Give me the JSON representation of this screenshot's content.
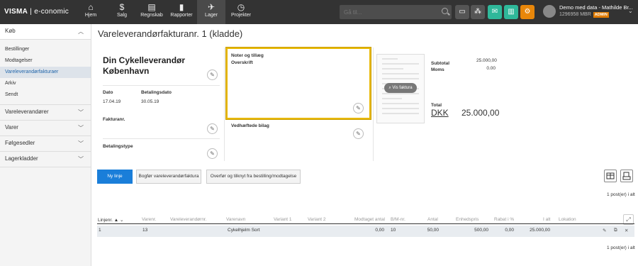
{
  "topbar": {
    "brand": "VISMA",
    "product": "e-conomic",
    "nav": [
      {
        "label": "Hjem",
        "icon": "home-icon"
      },
      {
        "label": "Salg",
        "icon": "dollar-icon"
      },
      {
        "label": "Regnskab",
        "icon": "ledger-icon"
      },
      {
        "label": "Rapporter",
        "icon": "bar-chart-icon"
      },
      {
        "label": "Lager",
        "icon": "box-icon"
      },
      {
        "label": "Projekter",
        "icon": "clock-icon"
      }
    ],
    "search_placeholder": "Gå til...",
    "user_name": "Demo med data - Mathilde Br...",
    "user_id": "1296958 MBR",
    "badge": "ADMIN"
  },
  "sidebar": {
    "kob": "Køb",
    "items": [
      "Bestillinger",
      "Modtagelser",
      "Vareleverandørfakturaer",
      "Arkiv",
      "Sendt"
    ],
    "sections": [
      "Vareleverandører",
      "Varer",
      "Følgesedler",
      "Lagerkladder"
    ]
  },
  "page": {
    "title": "Vareleverandørfakturanr. 1 (kladde)",
    "vendor_line1": "Din Cykelleverandør",
    "vendor_line2": "København",
    "dato_label": "Dato",
    "dato": "17.04.19",
    "betalingsdato_label": "Betalingsdato",
    "betalingsdato": "30.05.19",
    "fakturanr_label": "Fakturanr.",
    "betalingstype_label": "Betalingstype",
    "notes_label": "Noter og tillæg",
    "overskrift_label": "Overskrift",
    "attachments_label": "Vedhæftede bilag",
    "view_invoice": "Vis faktura",
    "subtotal_label": "Subtotal",
    "subtotal": "25.000,00",
    "moms_label": "Moms",
    "moms": "0.00",
    "total_label": "Total",
    "currency": "DKK",
    "total": "25.000,00"
  },
  "actions": {
    "new_line": "Ny linje",
    "book": "Bogfør vareleverandørfaktura",
    "transfer": "Overfør og tilknyt fra bestilling/modtagelse"
  },
  "posts_count": "1 post(er) i alt",
  "table": {
    "headers": [
      "Linjenr.",
      "Varenr.",
      "Vareleverandørnr.",
      "Varenavn",
      "Variant 1",
      "Variant 2",
      "Modtaget antal",
      "B/M-nr.",
      "Antal",
      "Enhedspris",
      "Rabat i %",
      "I alt",
      "Lokation"
    ],
    "row": [
      "1",
      "13",
      "",
      "Cykelhjelm Sort",
      "",
      "",
      "0,00",
      "10",
      "50,00",
      "500,00",
      "0,00",
      "25.000,00",
      ""
    ]
  }
}
